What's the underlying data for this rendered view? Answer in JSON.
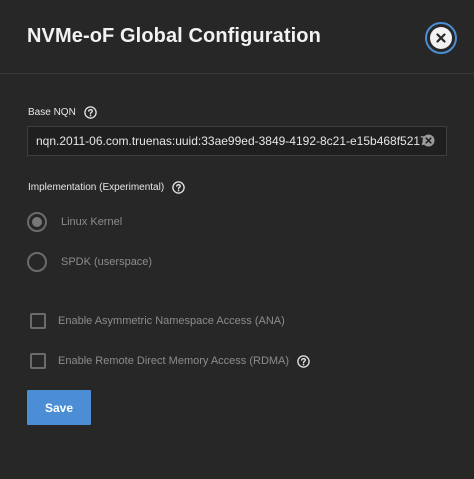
{
  "dialog": {
    "title": "NVMe-oF Global Configuration",
    "close_icon": "close-circle-icon"
  },
  "base_nqn": {
    "label": "Base NQN",
    "value": "nqn.2011-06.com.truenas:uuid:33ae99ed-3849-4192-8c21-e15b468f5217",
    "help_icon": "help-circle-icon",
    "clear_icon": "clear-circle-icon"
  },
  "implementation": {
    "label": "Implementation (Experimental)",
    "help_icon": "help-circle-icon",
    "options": [
      {
        "label": "Linux Kernel",
        "selected": true
      },
      {
        "label": "SPDK (userspace)",
        "selected": false
      }
    ]
  },
  "checkboxes": {
    "ana_label": "Enable Asymmetric Namespace Access (ANA)",
    "ana_checked": false,
    "rdma_label": "Enable Remote Direct Memory Access (RDMA)",
    "rdma_checked": false,
    "rdma_help_icon": "help-circle-icon"
  },
  "actions": {
    "save_label": "Save"
  },
  "colors": {
    "background": "#272727",
    "accent": "#4b8ed6",
    "muted_text": "#8c8c8c"
  }
}
